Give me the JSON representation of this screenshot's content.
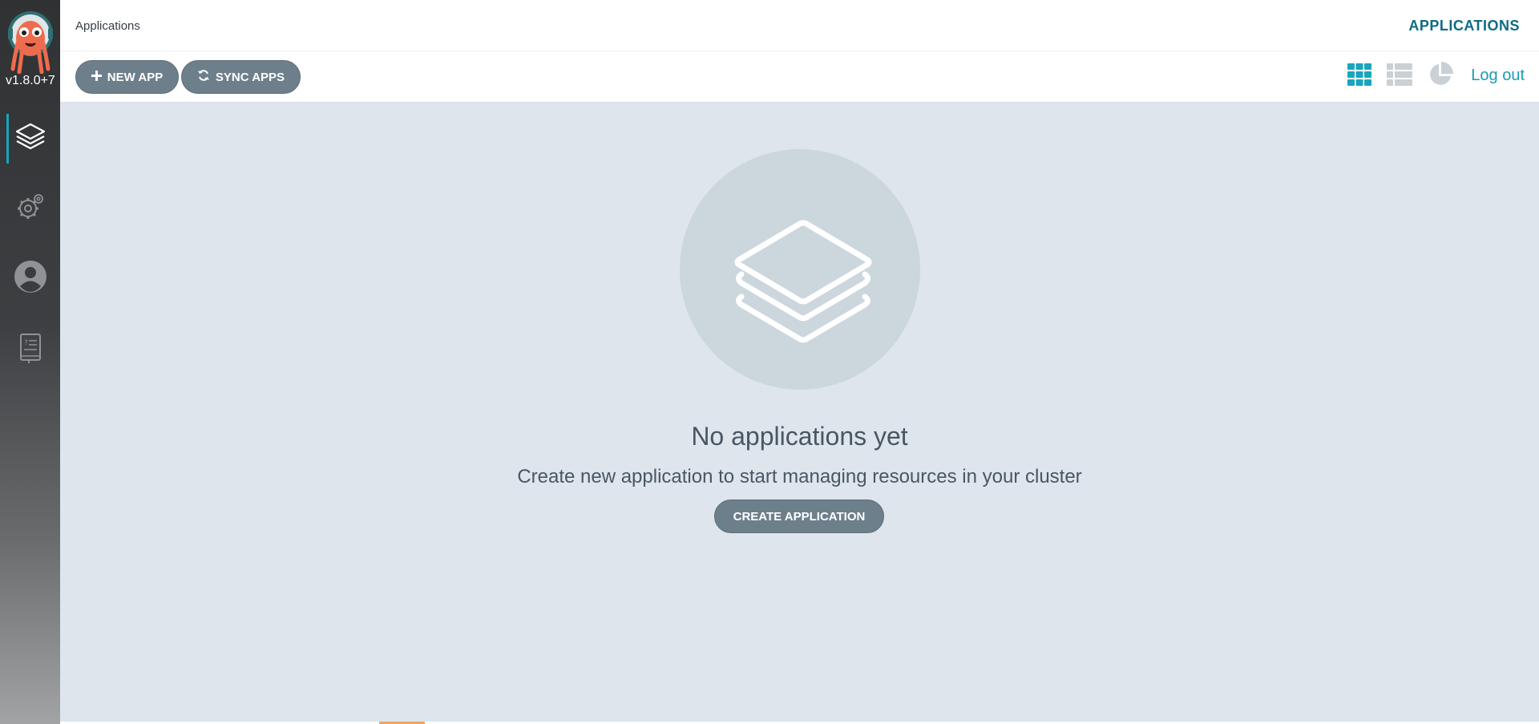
{
  "app": {
    "version": "v1.8.0+7"
  },
  "sidebar": {
    "items": [
      {
        "name": "applications",
        "icon": "layers-icon",
        "active": true
      },
      {
        "name": "settings",
        "icon": "gears-icon",
        "active": false
      },
      {
        "name": "user-info",
        "icon": "user-circle-icon",
        "active": false
      },
      {
        "name": "documentation",
        "icon": "docs-book-icon",
        "active": false
      }
    ]
  },
  "header": {
    "breadcrumb": "Applications",
    "title": "APPLICATIONS"
  },
  "toolbar": {
    "new_app_label": "NEW APP",
    "sync_apps_label": "SYNC APPS",
    "views": [
      {
        "name": "tiles-view",
        "icon": "grid-icon",
        "active": true
      },
      {
        "name": "list-view",
        "icon": "list-icon",
        "active": false
      },
      {
        "name": "summary-view",
        "icon": "pie-chart-icon",
        "active": false
      }
    ],
    "logout_label": "Log out"
  },
  "empty_state": {
    "icon": "layers-icon",
    "title": "No applications yet",
    "subtitle": "Create new application to start managing resources in your cluster",
    "button_label": "CREATE APPLICATION"
  },
  "colors": {
    "accent": "#18a5be",
    "header_title": "#0e6b84",
    "button": "#6d7f8b",
    "main_bg": "#dee5ec",
    "empty_circle": "#ccd6dd"
  }
}
